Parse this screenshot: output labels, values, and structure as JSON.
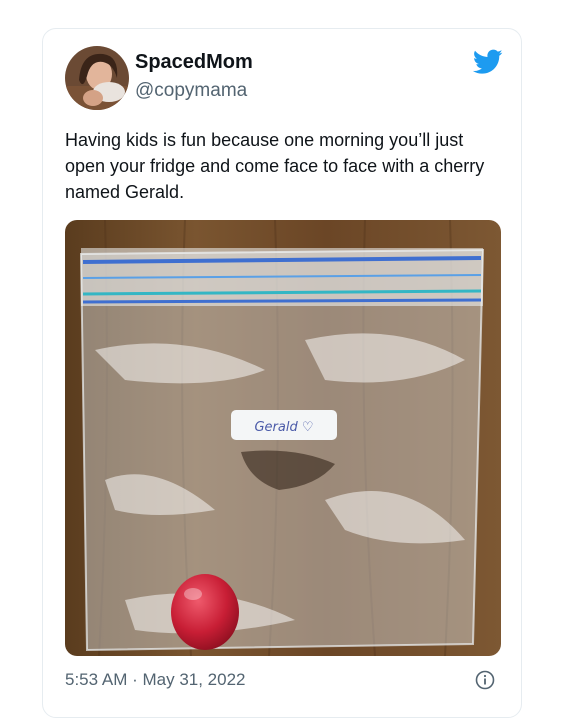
{
  "tweet": {
    "display_name": "SpacedMom",
    "handle": "@copymama",
    "text": "Having kids is fun because one morning you’ll just open your fridge and come face to face with a cherry named Gerald.",
    "timestamp": "5:53 AM · May 31, 2022",
    "photo_label": "Gerald ♡"
  },
  "icons": {
    "brand": "twitter-bird-icon",
    "info": "info-icon"
  },
  "colors": {
    "brand": "#1d9bf0",
    "secondary_text": "#536471"
  }
}
